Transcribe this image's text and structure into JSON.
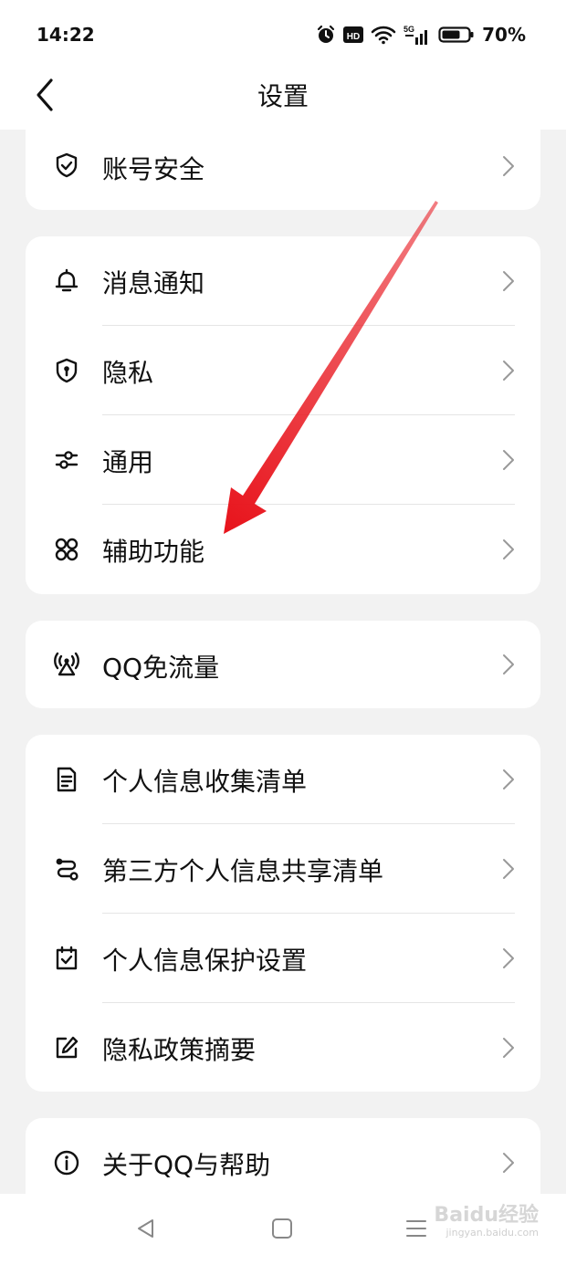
{
  "status": {
    "time": "14:22",
    "hd": "HD",
    "net": "5G",
    "battery": "70%"
  },
  "nav": {
    "title": "设置"
  },
  "groups": [
    {
      "items": [
        {
          "label": "账号安全",
          "icon": "shield-check-icon"
        }
      ]
    },
    {
      "items": [
        {
          "label": "消息通知",
          "icon": "bell-icon"
        },
        {
          "label": "隐私",
          "icon": "privacy-lock-shield-icon"
        },
        {
          "label": "通用",
          "icon": "sliders-icon"
        },
        {
          "label": "辅助功能",
          "icon": "command-icon"
        }
      ]
    },
    {
      "items": [
        {
          "label": "QQ免流量",
          "icon": "signal-tower-icon"
        }
      ]
    },
    {
      "items": [
        {
          "label": "个人信息收集清单",
          "icon": "document-list-icon"
        },
        {
          "label": "第三方个人信息共享清单",
          "icon": "share-route-icon"
        },
        {
          "label": "个人信息保护设置",
          "icon": "checkbox-icon"
        },
        {
          "label": "隐私政策摘要",
          "icon": "edit-icon"
        }
      ]
    },
    {
      "items": [
        {
          "label": "关于QQ与帮助",
          "icon": "info-icon"
        }
      ]
    }
  ],
  "watermark": {
    "text": "Baidu经验",
    "sub": "jingyan.baidu.com"
  },
  "colors": {
    "accent_arrow": "#e8141c",
    "background": "#f2f2f2",
    "card": "#ffffff"
  }
}
